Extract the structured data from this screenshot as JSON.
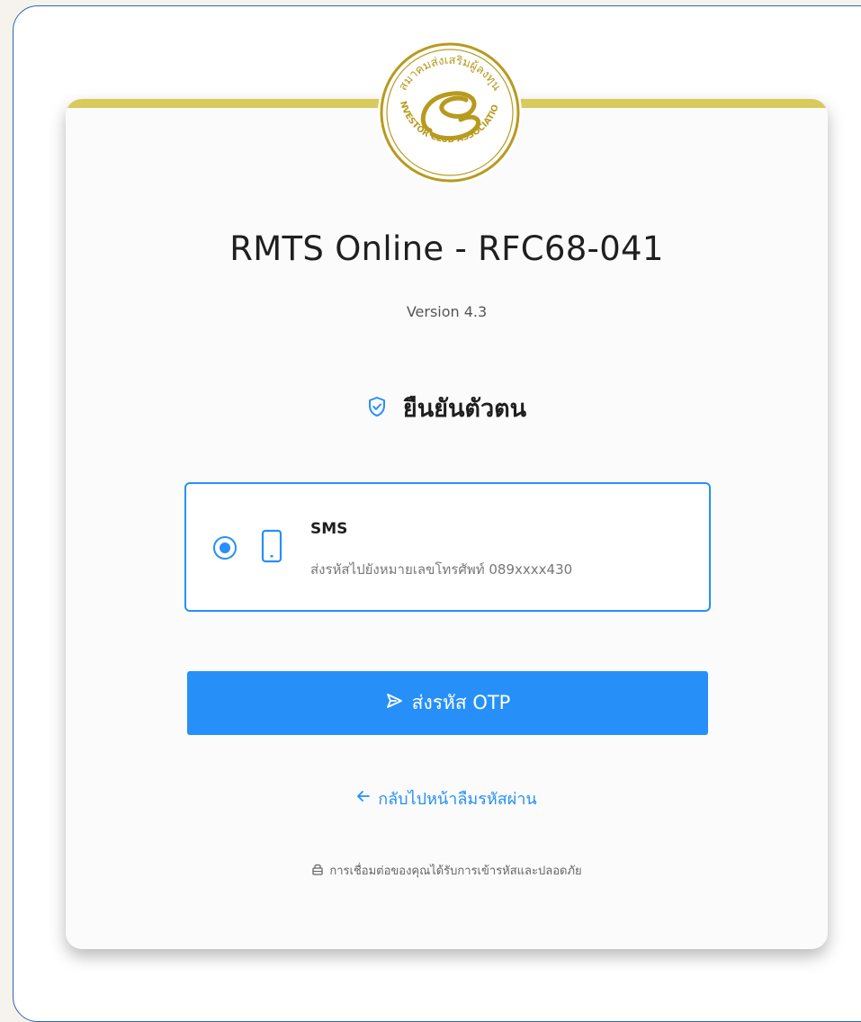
{
  "app": {
    "title": "RMTS Online - RFC68-041",
    "version": "Version 4.3",
    "logo_icon": "investor-club-association-logo",
    "logo_text_top": "สมาคมส่งเสริมผู้ลงทุน",
    "logo_text_bottom": "INVESTOR CLUB ASSOCIATION"
  },
  "verify": {
    "icon": "shield-check-icon",
    "title": "ยืนยันตัวตน"
  },
  "option": {
    "selected": true,
    "icon": "mobile-phone-icon",
    "name": "SMS",
    "description": "ส่งรหัสไปยังหมายเลขโทรศัพท์ 089xxxx430"
  },
  "actions": {
    "send_icon": "send-arrow-icon",
    "send_label": "ส่งรหัส OTP",
    "back_icon": "arrow-left-icon",
    "back_label": "กลับไปหน้าลืมรหัสผ่าน"
  },
  "footer": {
    "lock_icon": "lock-icon",
    "note": "การเชื่อมต่อของคุณได้รับการเข้ารหัสและปลอดภัย"
  },
  "colors": {
    "accent": "#2690f8",
    "gold": "#d8cb5c",
    "logo_gold": "#b89a1e"
  }
}
